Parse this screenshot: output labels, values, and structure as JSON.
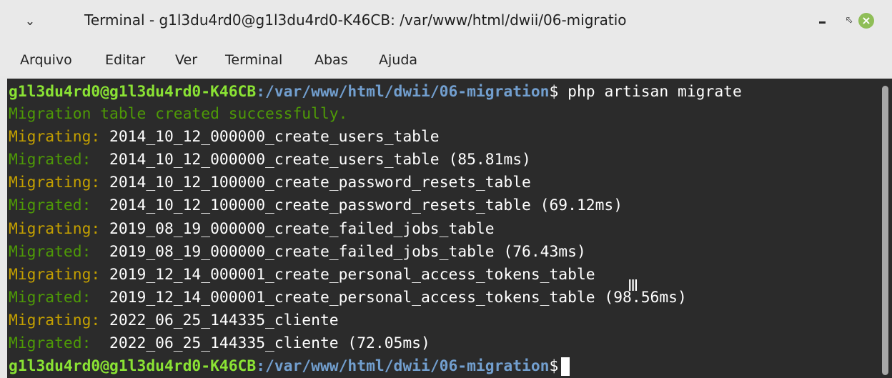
{
  "window": {
    "title": "Terminal - g1l3du4rd0@g1l3du4rd0-K46CB: /var/www/html/dwii/06-migratio",
    "controls": {
      "minimize": "minimize-icon",
      "maximize": "maximize-icon",
      "close": "close-icon"
    }
  },
  "menu": [
    "Arquivo",
    "Editar",
    "Ver",
    "Terminal",
    "Abas",
    "Ajuda"
  ],
  "terminal": {
    "prompt_user": "g1l3du4rd0@g1l3du4rd0-K46CB",
    "prompt_path": ":/var/www/html/dwii/06-migration",
    "prompt_symbol": "$",
    "command": " php artisan migrate",
    "status_line": "Migration table created successfully.",
    "migrations": [
      {
        "migrating": "Migrating:",
        "name": " 2014_10_12_000000_create_users_table",
        "migrated": "Migrated: ",
        "done": " 2014_10_12_000000_create_users_table (85.81ms)"
      },
      {
        "migrating": "Migrating:",
        "name": " 2014_10_12_100000_create_password_resets_table",
        "migrated": "Migrated: ",
        "done": " 2014_10_12_100000_create_password_resets_table (69.12ms)"
      },
      {
        "migrating": "Migrating:",
        "name": " 2019_08_19_000000_create_failed_jobs_table",
        "migrated": "Migrated: ",
        "done": " 2019_08_19_000000_create_failed_jobs_table (76.43ms)"
      },
      {
        "migrating": "Migrating:",
        "name": " 2019_12_14_000001_create_personal_access_tokens_table",
        "migrated": "Migrated: ",
        "done": " 2019_12_14_000001_create_personal_access_tokens_table (98.56ms)"
      },
      {
        "migrating": "Migrating:",
        "name": " 2022_06_25_144335_cliente",
        "migrated": "Migrated: ",
        "done": " 2022_06_25_144335_cliente (72.05ms)"
      }
    ]
  },
  "colors": {
    "background": "#2b2b2b",
    "prompt_user": "#8ae234",
    "prompt_path": "#729fcf",
    "migrating": "#c4a000",
    "migrated": "#4e9a06"
  }
}
